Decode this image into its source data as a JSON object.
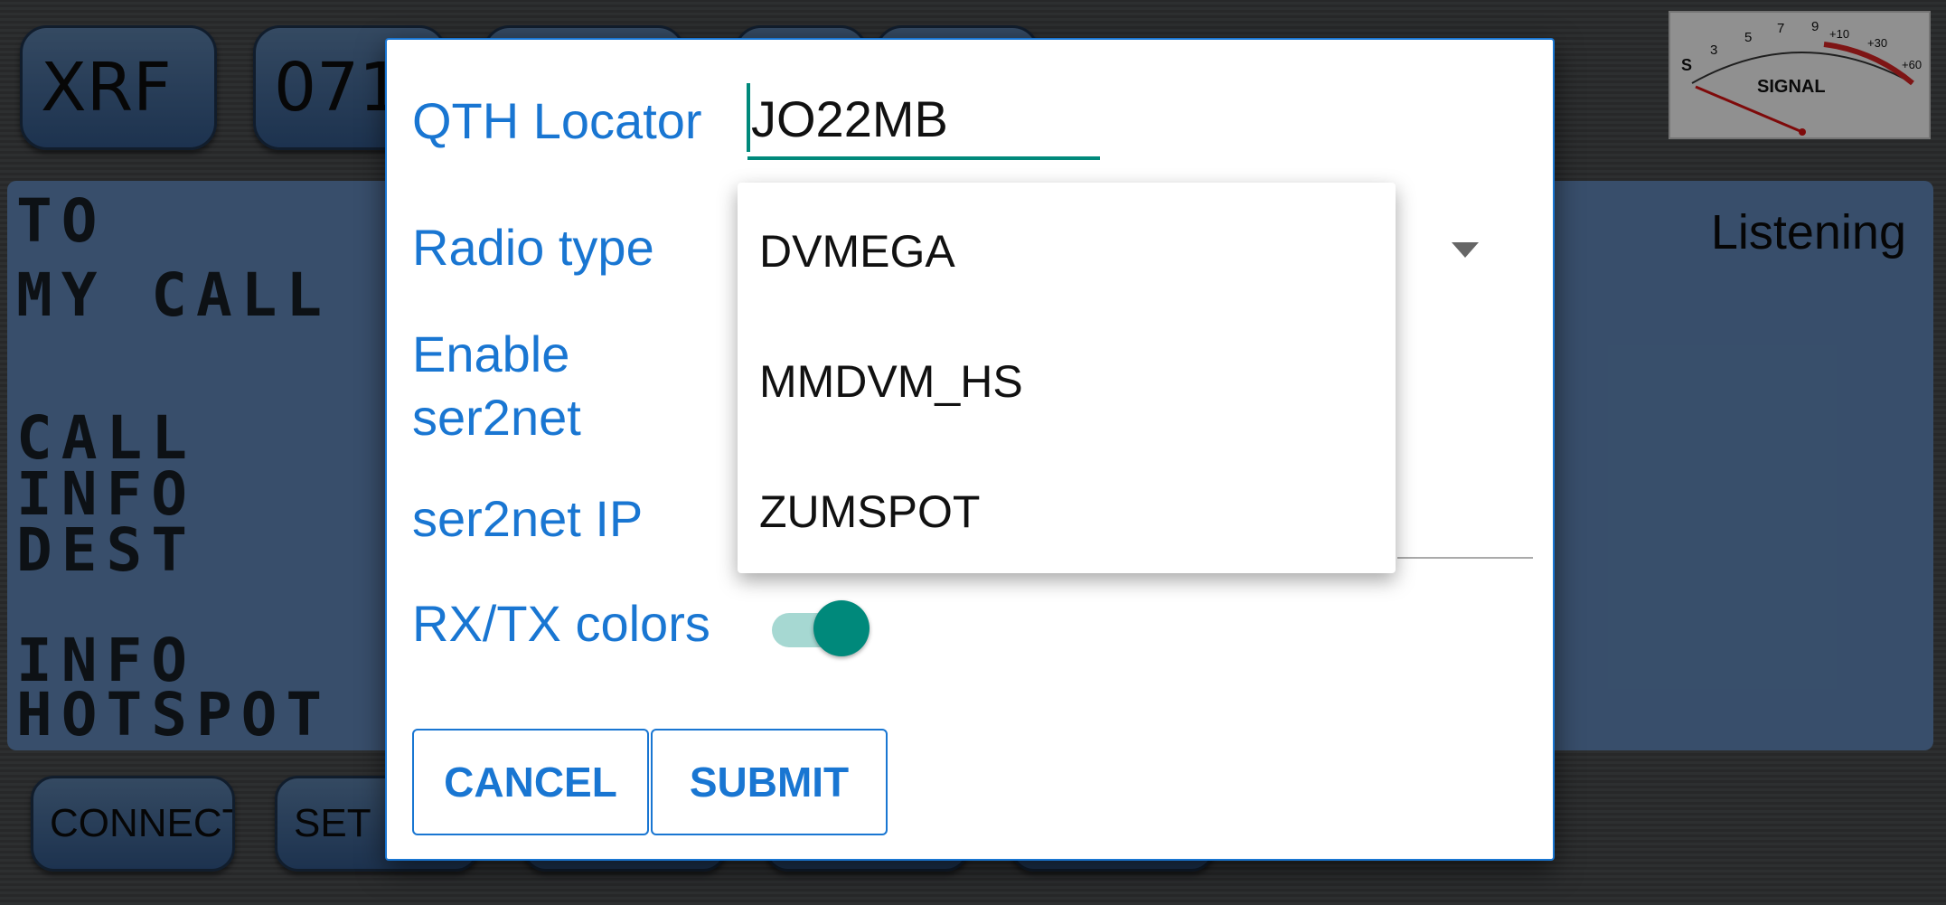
{
  "app": {
    "top_buttons": [
      "XRF",
      "071",
      "",
      "",
      ""
    ],
    "lcd_lines": [
      "TO",
      "MY CALL",
      "CALL",
      "INFO",
      "DEST",
      "INFO",
      "HOTSPOT"
    ],
    "status": "Listening",
    "meter": {
      "scale_labels": [
        "S",
        "3",
        "5",
        "7",
        "9",
        "+10",
        "+30",
        "+60"
      ],
      "title": "SIGNAL"
    },
    "bottom_buttons": [
      "CONNECT",
      "SET",
      "",
      "",
      ""
    ]
  },
  "dialog": {
    "qth_label": "QTH Locator",
    "qth_value": "JO22MB",
    "radio_label": "Radio type",
    "ser2net_label_line1": "Enable",
    "ser2net_label_line2": "ser2net",
    "ser2net_ip_label": "ser2net IP",
    "colors_label": "RX/TX colors",
    "colors_enabled": true,
    "cancel": "CANCEL",
    "submit": "SUBMIT"
  },
  "dropdown": {
    "options": [
      "DVMEGA",
      "MMDVM_HS",
      "ZUMSPOT"
    ]
  },
  "colors": {
    "accent_blue": "#1976d2",
    "accent_teal": "#00897b",
    "lcd_blue": "#5b7fad"
  }
}
